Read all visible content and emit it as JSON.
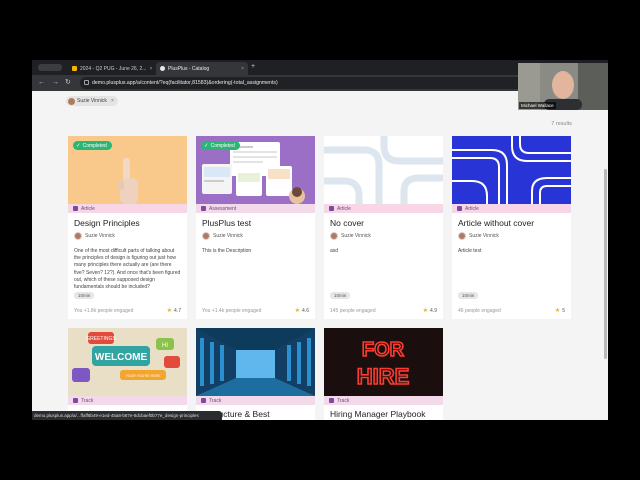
{
  "browser": {
    "tabs": [
      {
        "label": "2024 - Q2 PUG - June 26, 2...",
        "active": false,
        "favicon_color": "#f4b400"
      },
      {
        "label": "PlusPlus - Catalog",
        "active": true,
        "favicon_color": "#1f2023"
      }
    ],
    "new_tab_label": "+",
    "url": "demo.plusplus.app/a/content/?eq(facilitator,81583)&ordering(-total_assignments)"
  },
  "page": {
    "filter_chip": {
      "label": "Suzie Vinnick",
      "remove": "×"
    },
    "results_count": "7 results",
    "cards": [
      {
        "id": "design-principles",
        "completed_label": "Completed",
        "type": "Article",
        "type_color": "#f7d6e6",
        "title": "Design Principles",
        "author": "Suzie Vinnick",
        "description": "One of the most difficult parts of talking about the principles of design is figuring out just how many principles there actually are (are there five? Seven? 12?). And once that's been figured out, which of these supposed design fundamentals should be included?",
        "duration": "10min",
        "engaged": "You +1.8k people engaged",
        "rating": "4.7"
      },
      {
        "id": "plusplus-test",
        "completed_label": "Completed",
        "type": "Assessment",
        "type_color": "#f3d9ea",
        "title": "PlusPlus test",
        "author": "Suzie Vinnick",
        "description": "This is the Description",
        "duration": "",
        "engaged": "You +1.4k people engaged",
        "rating": "4.6"
      },
      {
        "id": "no-cover",
        "completed_label": "",
        "type": "Article",
        "type_color": "#f7d6e6",
        "title": "No cover",
        "author": "Suzie Vinnick",
        "description": "asd",
        "duration": "10min",
        "engaged": "145 people engaged",
        "rating": "4.9"
      },
      {
        "id": "article-without-cover",
        "completed_label": "",
        "type": "Article",
        "type_color": "#f7d6e6",
        "title": "Article without cover",
        "author": "Suzie Vinnick",
        "description": "Article test",
        "duration": "10min",
        "engaged": "46 people engaged",
        "rating": "5"
      },
      {
        "id": "welcome-track",
        "type": "Track",
        "type_color": "#f3d9ea",
        "title": "",
        "thumb_words": {
          "greetings": "GREETINGS",
          "welcome": "WELCOME",
          "hi": "HI",
          "sub": "YOUR YOU'RE HERE"
        }
      },
      {
        "id": "infrastructure-track",
        "type": "Track",
        "type_color": "#f3d9ea",
        "title": "...structure & Best"
      },
      {
        "id": "hiring-track",
        "type": "Track",
        "type_color": "#f3d9ea",
        "title": "Hiring Manager Playbook",
        "thumb_words": {
          "line1": "FOR",
          "line2": "HIRE"
        }
      }
    ]
  },
  "status_bar_url": "demo.plusplus.app/a/...ffaff8b49-e1ed-45a8-b87e-8dcbaef0b77e_design-principles",
  "webcam_name": "Michael Wallace",
  "colors": {
    "accent_purple": "#7a4ba0",
    "completed_green": "#2bb673",
    "star": "#f5b400"
  }
}
